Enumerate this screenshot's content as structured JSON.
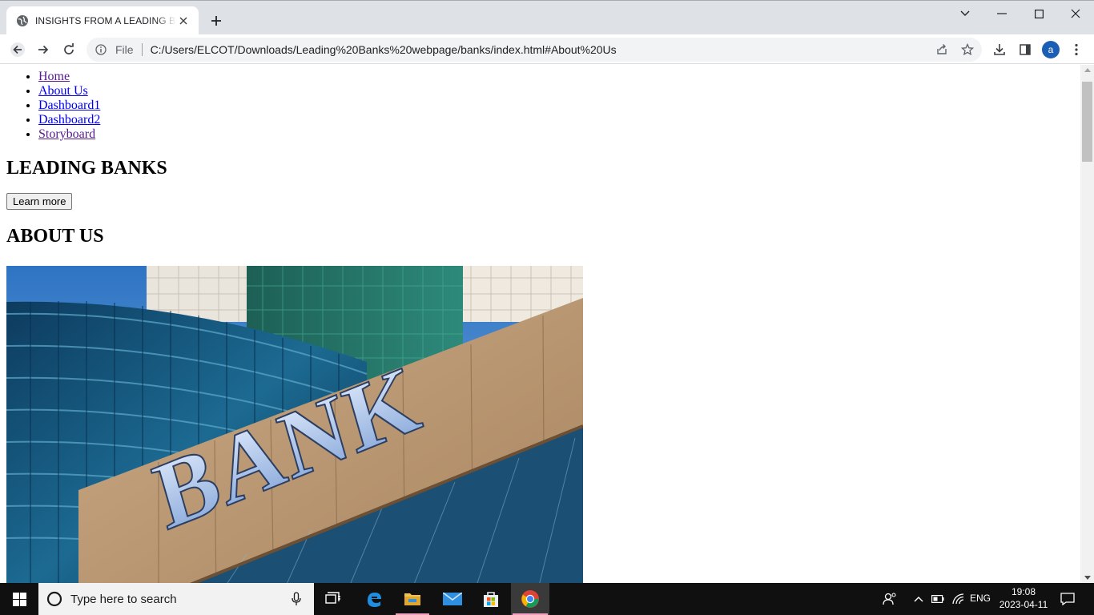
{
  "browser": {
    "tab_title": "INSIGHTS FROM A LEADING BANKS",
    "address_scheme": "File",
    "address_url": "C:/Users/ELCOT/Downloads/Leading%20Banks%20webpage/banks/index.html#About%20Us",
    "profile_initial": "a",
    "icons": [
      "back-arrow-icon",
      "forward-arrow-icon",
      "reload-icon",
      "info-icon",
      "share-icon",
      "star-icon",
      "download-icon",
      "side-panel-icon",
      "kebab-menu-icon"
    ]
  },
  "page": {
    "nav": [
      "Home",
      "About Us",
      "Dashboard1",
      "Dashboard2",
      "Storyboard"
    ],
    "heading": "LEADING BANKS",
    "learn_more": "Learn more",
    "about_heading": "ABOUT US",
    "image_sign_text": "BANK"
  },
  "taskbar": {
    "search_placeholder": "Type here to search",
    "language": "ENG",
    "time": "19:08",
    "date": "2023-04-11"
  }
}
